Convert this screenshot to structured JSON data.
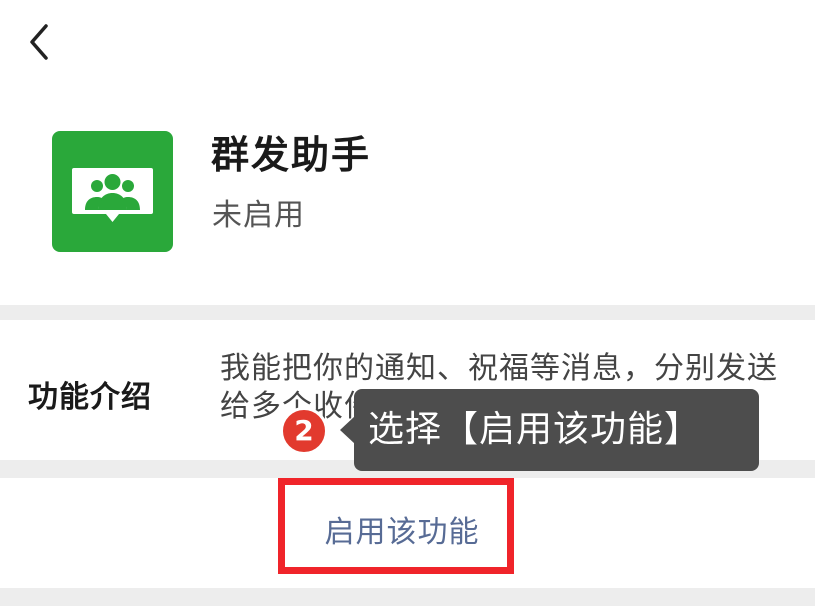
{
  "navigation": {
    "back_icon": "chevron-left-icon"
  },
  "app": {
    "icon": "group-people-chat-icon",
    "icon_color": "#2aa83a",
    "title": "群发助手",
    "status": "未启用"
  },
  "intro": {
    "label": "功能介绍",
    "description": "我能把你的通知、祝福等消息，分别发送给多个收件人"
  },
  "actions": {
    "enable_label": "启用该功能",
    "enable_color": "#576b95"
  },
  "annotation": {
    "step_number": "2",
    "tooltip_text": "选择【启用该功能】",
    "highlight_color": "#f0242a",
    "badge_color": "#e23a2e"
  }
}
